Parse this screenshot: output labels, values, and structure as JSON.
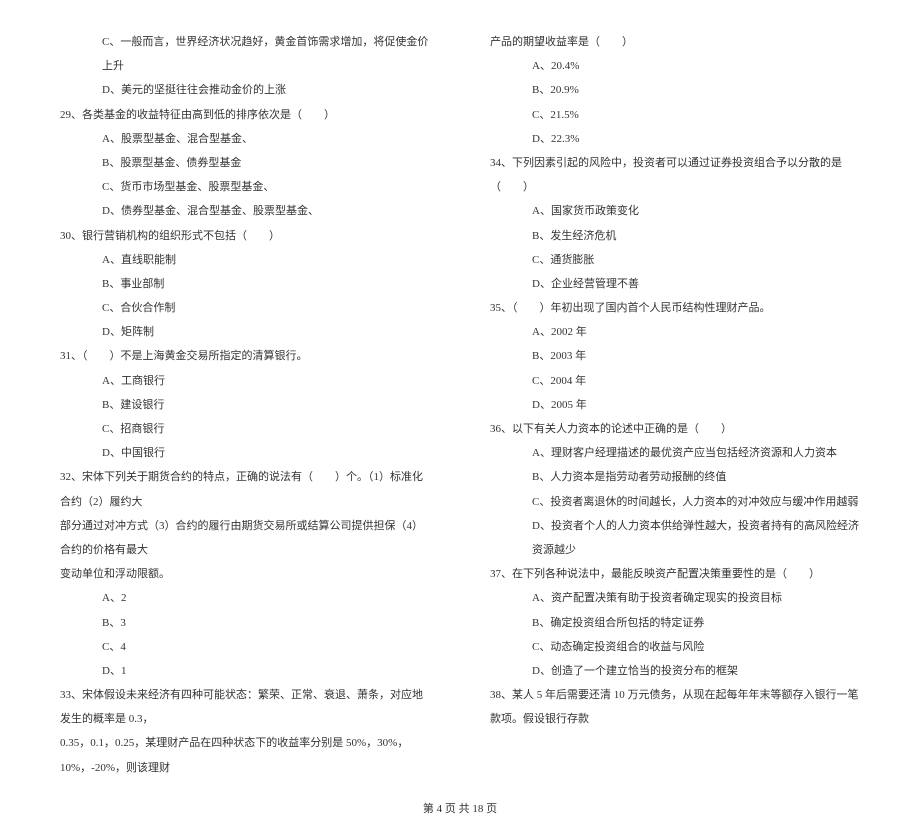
{
  "left": {
    "q28_c": "C、一般而言，世界经济状况趋好，黄金首饰需求增加，将促使金价上升",
    "q28_d": "D、美元的坚挺往往会推动金价的上涨",
    "q29": "29、各类基金的收益特征由高到低的排序依次是（　　）",
    "q29_a": "A、股票型基金、混合型基金、",
    "q29_b": "B、股票型基金、债券型基金",
    "q29_c": "C、货币市场型基金、股票型基金、",
    "q29_d": "D、债券型基金、混合型基金、股票型基金、",
    "q30": "30、银行营销机构的组织形式不包括（　　）",
    "q30_a": "A、直线职能制",
    "q30_b": "B、事业部制",
    "q30_c": "C、合伙合作制",
    "q30_d": "D、矩阵制",
    "q31": "31、（　　）不是上海黄金交易所指定的清算银行。",
    "q31_a": "A、工商银行",
    "q31_b": "B、建设银行",
    "q31_c": "C、招商银行",
    "q31_d": "D、中国银行",
    "q32_1": "32、宋体下列关于期货合约的特点，正确的说法有（　　）个。（1）标准化合约（2）履约大",
    "q32_2": "部分通过对冲方式（3）合约的履行由期货交易所或结算公司提供担保（4）合约的价格有最大",
    "q32_3": "变动单位和浮动限额。",
    "q32_a": "A、2",
    "q32_b": "B、3",
    "q32_c": "C、4",
    "q32_d": "D、1",
    "q33_1": "33、宋体假设未来经济有四种可能状态：繁荣、正常、衰退、萧条，对应地发生的概率是 0.3，",
    "q33_2": "0.35，0.1，0.25，某理财产品在四种状态下的收益率分别是 50%，30%，10%，-20%，则该理财"
  },
  "right": {
    "q33_3": "产品的期望收益率是（　　）",
    "q33_a": "A、20.4%",
    "q33_b": "B、20.9%",
    "q33_c": "C、21.5%",
    "q33_d": "D、22.3%",
    "q34": "34、下列因素引起的风险中，投资者可以通过证券投资组合予以分散的是（　　）",
    "q34_a": "A、国家货币政策变化",
    "q34_b": "B、发生经济危机",
    "q34_c": "C、通货膨胀",
    "q34_d": "D、企业经营管理不善",
    "q35": "35、（　　）年初出现了国内首个人民币结构性理财产品。",
    "q35_a": "A、2002 年",
    "q35_b": "B、2003 年",
    "q35_c": "C、2004 年",
    "q35_d": "D、2005 年",
    "q36": "36、以下有关人力资本的论述中正确的是（　　）",
    "q36_a": "A、理财客户经理描述的最优资产应当包括经济资源和人力资本",
    "q36_b": "B、人力资本是指劳动者劳动报酬的终值",
    "q36_c": "C、投资者离退休的时间越长，人力资本的对冲效应与缓冲作用越弱",
    "q36_d": "D、投资者个人的人力资本供给弹性越大，投资者持有的高风险经济资源越少",
    "q37": "37、在下列各种说法中，最能反映资产配置决策重要性的是（　　）",
    "q37_a": "A、资产配置决策有助于投资者确定现实的投资目标",
    "q37_b": "B、确定投资组合所包括的特定证券",
    "q37_c": "C、动态确定投资组合的收益与风险",
    "q37_d": "D、创造了一个建立恰当的投资分布的框架",
    "q38": "38、某人 5 年后需要还清 10 万元债务，从现在起每年年末等额存入银行一笔款项。假设银行存款"
  },
  "footer": "第 4 页 共 18 页"
}
